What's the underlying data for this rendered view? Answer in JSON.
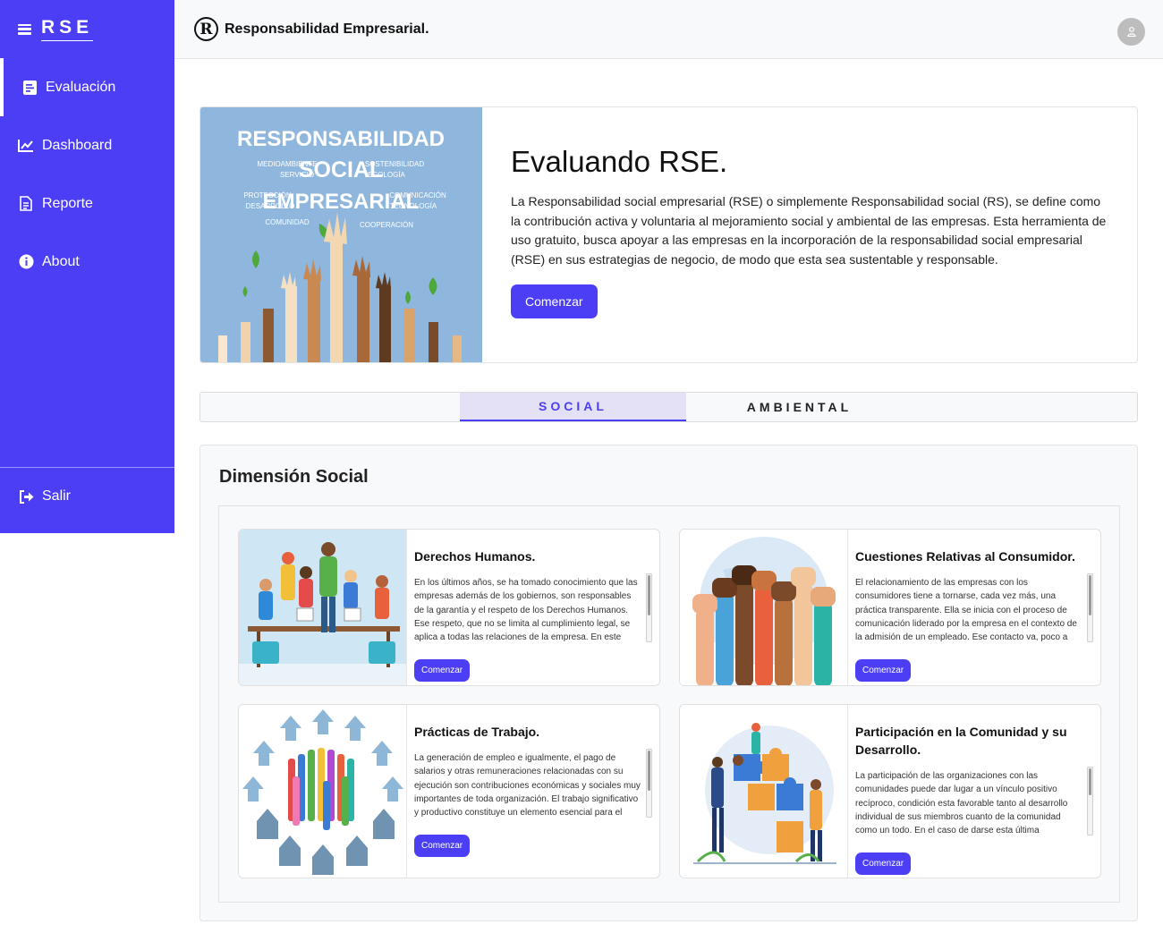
{
  "sidebar": {
    "brand": "RSE",
    "items": [
      {
        "label": "Evaluación",
        "icon": "form-icon"
      },
      {
        "label": "Dashboard",
        "icon": "chart-icon"
      },
      {
        "label": "Reporte",
        "icon": "document-icon"
      },
      {
        "label": "About",
        "icon": "info-icon"
      }
    ],
    "logout": {
      "label": "Salir",
      "icon": "sign-out-icon"
    }
  },
  "header": {
    "logo_letter": "R",
    "title": "Responsabilidad Empresarial."
  },
  "hero": {
    "title": "Evaluando RSE.",
    "text": "La Responsabilidad social empresarial (RSE) o simplemente Responsabilidad social (RS), se define como la contribución activa y voluntaria al mejoramiento social y ambiental de las empresas. Esta herramienta de uso gratuito, busca apoyar a las empresas en la incorporación de la responsabilidad social empresarial (RSE) en sus estrategias de negocio, de modo que esta sea sustentable y responsable.",
    "button": "Comenzar",
    "image_words": {
      "w1": "RESPONSABILIDAD",
      "w2": "MEDIOAMBIENTE",
      "w3": "SERVICIO",
      "w4": "SOCIAL",
      "w5": "SOSTENIBILIDAD",
      "w6": "ECOLOGÍA",
      "w7": "PROTECCIÓN",
      "w8": "DESARROLLO",
      "w9": "EMPRESARIAL",
      "w10": "COMUNICACIÓN",
      "w11": "TECNOLOGÍA",
      "w12": "COMUNIDAD",
      "w13": "COOPERACIÓN"
    }
  },
  "tabs": [
    {
      "label": "SOCIAL",
      "active": true
    },
    {
      "label": "AMBIENTAL",
      "active": false
    }
  ],
  "dimension": {
    "title": "Dimensión Social",
    "cards": [
      {
        "title": "Derechos Humanos.",
        "text": "En los últimos años, se ha tomado conocimiento que las empresas además de los gobiernos, son responsables de la garantía y el respeto de los Derechos Humanos. Ese respeto, que no se limita al cumplimiento legal, se aplica a todas las relaciones de la empresa. En este",
        "button": "Comenzar"
      },
      {
        "title": "Cuestiones Relativas al Consumidor.",
        "text": "El relacionamiento de las empresas con los consumidores tiene a tornarse, cada vez más, una práctica transparente. Ella se inicia con el proceso de comunicación liderado por la empresa en el contexto de la admisión de un empleado. Ese contacto va, poco a",
        "button": "Comenzar"
      },
      {
        "title": "Prácticas de Trabajo.",
        "text": "La generación de empleo e igualmente, el pago de salarios y otras remuneraciones relacionadas con su ejecución son contribuciones económicas y sociales muy importantes de toda organización. El trabajo significativo y productivo constituye un elemento esencial para el",
        "button": "Comenzar"
      },
      {
        "title": "Participación en la Comunidad y su Desarrollo.",
        "text": "La participación de las organizaciones con las comunidades puede dar lugar a un vínculo positivo recíproco, condición esta favorable tanto al desarrollo individual de sus miembros cuanto de la comunidad como un todo. En el caso de darse esta última",
        "button": "Comenzar"
      }
    ]
  },
  "colors": {
    "accent": "#4b3ef5",
    "tab_active_bg": "#e4e1f7"
  }
}
